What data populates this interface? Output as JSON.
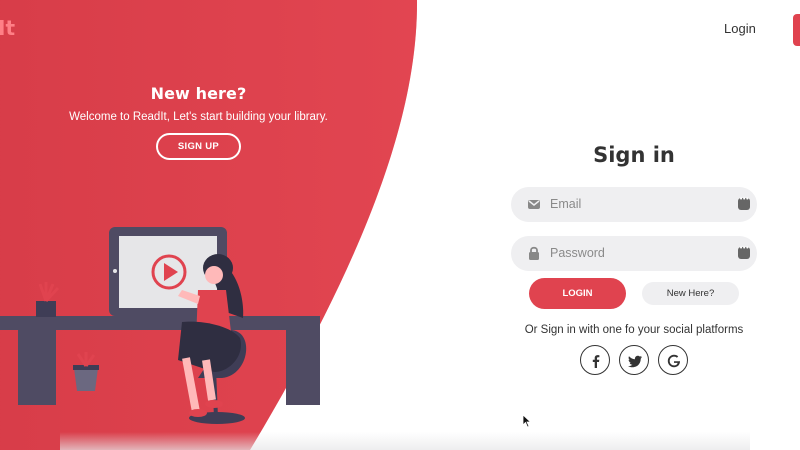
{
  "colors": {
    "accent": "#e0434f",
    "logo": "#ff7f86",
    "field_bg": "#efeff1",
    "text": "#333333"
  },
  "header": {
    "logo_text": "It",
    "login_link": "Login"
  },
  "promo": {
    "title": "New here?",
    "subtitle": "Welcome to ReadIt, Let's start building your library.",
    "signup_label": "SIGN UP"
  },
  "signin": {
    "title": "Sign in",
    "email_placeholder": "Email",
    "password_placeholder": "Password",
    "login_label": "LOGIN",
    "new_here_label": "New Here?",
    "social_text": "Or Sign in with one fo your social platforms",
    "social_icons": [
      "facebook-icon",
      "twitter-icon",
      "google-icon"
    ]
  }
}
